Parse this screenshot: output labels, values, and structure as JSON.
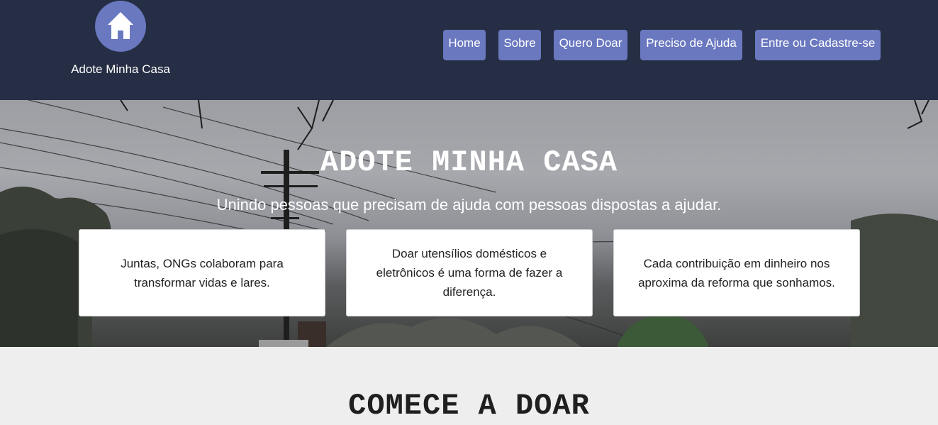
{
  "header": {
    "brand_name": "Adote Minha Casa",
    "logo_icon": "house-icon",
    "nav": [
      {
        "label": "Home"
      },
      {
        "label": "Sobre"
      },
      {
        "label": "Quero Doar"
      },
      {
        "label": "Preciso de Ajuda"
      },
      {
        "label": "Entre ou Cadastre-se"
      }
    ]
  },
  "hero": {
    "title": "ADOTE MINHA CASA",
    "subtitle": "Unindo pessoas que precisam de ajuda com pessoas dispostas a ajudar.",
    "cards": [
      {
        "text": "Juntas, ONGs colaboram para transformar vidas e lares."
      },
      {
        "text": "Doar utensílios domésticos e eletrônicos é uma forma de fazer a diferença."
      },
      {
        "text": "Cada contribuição em dinheiro nos aproxima da reforma que sonhamos."
      }
    ]
  },
  "section": {
    "title": "COMECE A DOAR"
  },
  "colors": {
    "header_bg": "#262e45",
    "accent": "#6a78c0",
    "page_bg": "#eeeeee"
  }
}
